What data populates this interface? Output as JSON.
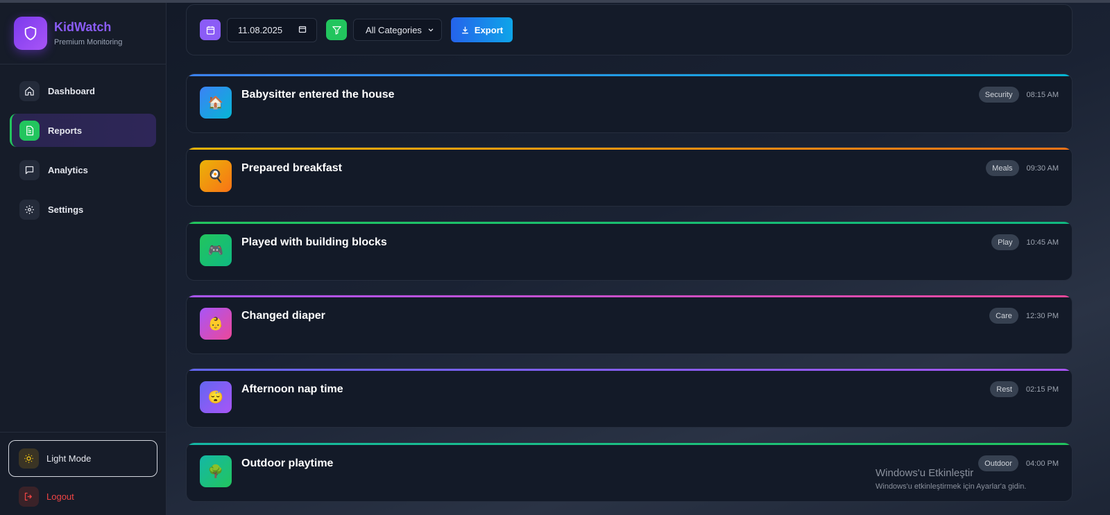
{
  "brand": {
    "name": "KidWatch",
    "subtitle": "Premium Monitoring"
  },
  "nav": {
    "items": [
      {
        "label": "Dashboard",
        "icon": "home-icon"
      },
      {
        "label": "Reports",
        "icon": "document-icon",
        "active": true
      },
      {
        "label": "Analytics",
        "icon": "message-icon"
      },
      {
        "label": "Settings",
        "icon": "gear-icon"
      }
    ]
  },
  "footer": {
    "light_mode": "Light Mode",
    "logout": "Logout"
  },
  "toolbar": {
    "date_value": "11.08.2025",
    "category_selected": "All Categories",
    "export_label": "Export"
  },
  "activities": [
    {
      "title": "Babysitter entered the house",
      "category": "Security",
      "time": "08:15 AM",
      "emoji": "🏠",
      "colors": [
        "#3b82f6",
        "#06b6d4"
      ]
    },
    {
      "title": "Prepared breakfast",
      "category": "Meals",
      "time": "09:30 AM",
      "emoji": "🍳",
      "colors": [
        "#eab308",
        "#f97316"
      ]
    },
    {
      "title": "Played with building blocks",
      "category": "Play",
      "time": "10:45 AM",
      "emoji": "🎮",
      "colors": [
        "#22c55e",
        "#10b981"
      ]
    },
    {
      "title": "Changed diaper",
      "category": "Care",
      "time": "12:30 PM",
      "emoji": "👶",
      "colors": [
        "#a855f7",
        "#ec4899"
      ]
    },
    {
      "title": "Afternoon nap time",
      "category": "Rest",
      "time": "02:15 PM",
      "emoji": "😴",
      "colors": [
        "#6366f1",
        "#a855f7"
      ]
    },
    {
      "title": "Outdoor playtime",
      "category": "Outdoor",
      "time": "04:00 PM",
      "emoji": "🌳",
      "colors": [
        "#14b8a6",
        "#22c55e"
      ]
    }
  ],
  "watermark": {
    "title": "Windows'u Etkinleştir",
    "subtitle": "Windows'u etkinleştirmek için Ayarlar'a gidin."
  }
}
